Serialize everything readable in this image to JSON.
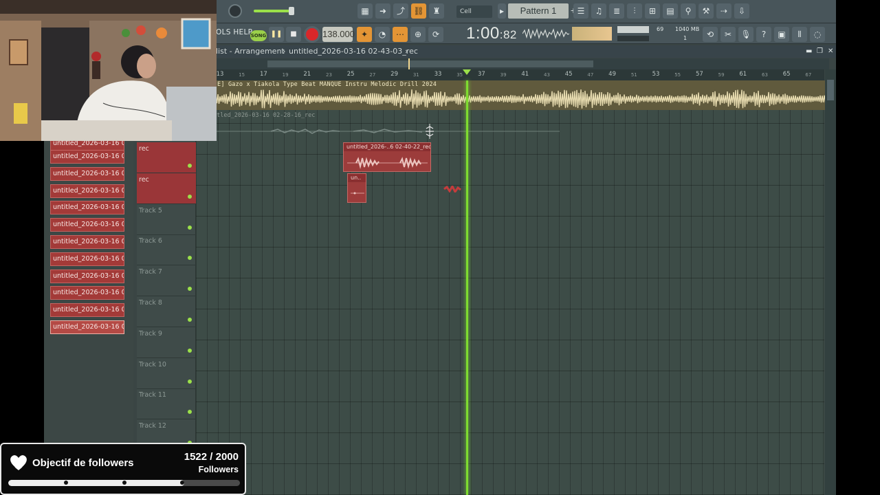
{
  "toolbar": {
    "menu_fragment": "OLS  HELP",
    "song_mode_label": "SONG",
    "tempo": "138.000",
    "time_main": "1:00",
    "time_sub": ":82",
    "snap_label": "Cell",
    "pattern_label": "Pattern 1",
    "cpu_value": "69",
    "memory": "1040 MB",
    "polyphony": "1",
    "play_icon": "play-pause-icon",
    "stop_icon": "stop-icon",
    "record_icon": "record-icon",
    "icons": [
      "piano-roll-icon",
      "arrow-right-icon",
      "step-icon",
      "link-icon",
      "metronome-icon",
      "pattern-nav-icon",
      "mixer-icon",
      "channel-rack-icon",
      "browser-icon",
      "plugin-icon",
      "tools-icon",
      "help-icon",
      "save-icon",
      "chat-icon"
    ],
    "accent_color": "#e49535"
  },
  "breadcrumb": {
    "window": "Playlist - Arrangement",
    "window_short": "list - Arrangement",
    "separator": "›",
    "project": "untitled_2026-03-16 02-43-03_rec"
  },
  "ruler": {
    "bars": [
      "13",
      "15",
      "17",
      "19",
      "21",
      "23",
      "25",
      "27",
      "29",
      "31",
      "33",
      "35",
      "37",
      "39",
      "41",
      "43",
      "45",
      "47",
      "49",
      "51",
      "53",
      "55",
      "57",
      "59",
      "61",
      "63",
      "65",
      "67"
    ],
    "playhead_bar": 36
  },
  "arrangement": {
    "top_clip_label": "E] Gazo x Tiakola Type Beat MANQUE  Instru Melodic Drill 2024",
    "second_clip_label": "itled_2026-03-16 02-28-16_rec",
    "rec_clip_1": "untitled_2026-..6 02-40-22_rec",
    "rec_clip_2": "un..",
    "playhead_color": "#7fdc30"
  },
  "tracks": [
    {
      "name": "rec",
      "armed": true
    },
    {
      "name": "rec",
      "armed": true
    },
    {
      "name": "Track 5",
      "armed": false
    },
    {
      "name": "Track 6",
      "armed": false
    },
    {
      "name": "Track 7",
      "armed": false
    },
    {
      "name": "Track 8",
      "armed": false
    },
    {
      "name": "Track 9",
      "armed": false
    },
    {
      "name": "Track 10",
      "armed": false
    },
    {
      "name": "Track 11",
      "armed": false
    },
    {
      "name": "Track 12",
      "armed": false
    }
  ],
  "clip_list": [
    "untitled_2026-03-16 02..",
    "untitled_2026-03-16 02..",
    "untitled_2026-03-16 02..",
    "untitled_2026-03-16 02..",
    "untitled_2026-03-16 02..",
    "untitled_2026-03-16 02..",
    "untitled_2026-03-16 02..",
    "untitled_2026-03-16 02..",
    "untitled_2026-03-16 02..",
    "untitled_2026-03-16 02..",
    "untitled_2026-03-16 02..",
    "untitled_2026-03-16 02.."
  ],
  "goal": {
    "title": "Objectif de followers",
    "current": "1522",
    "target": "2000",
    "count_text": "1522 / 2000",
    "unit": "Followers",
    "progress": 0.761,
    "icon": "heart-hands-icon"
  }
}
